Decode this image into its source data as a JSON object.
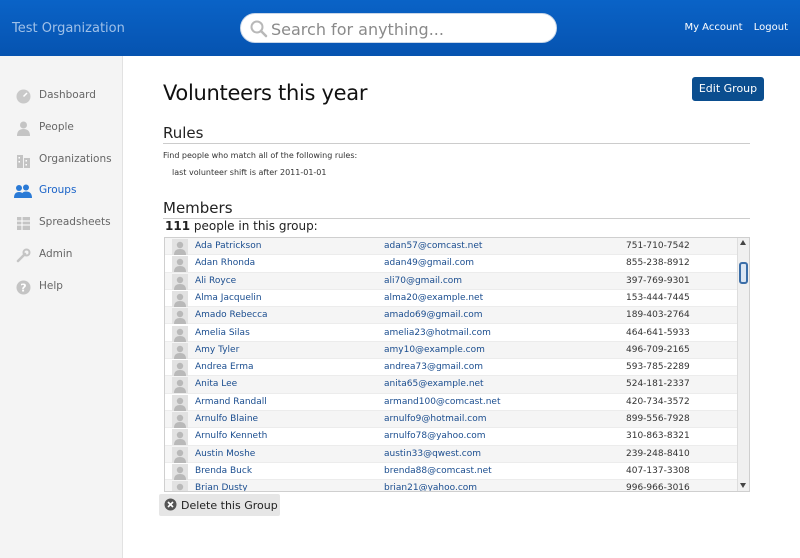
{
  "header": {
    "org_name": "Test Organization",
    "search_placeholder": "Search for anything...",
    "my_account": "My Account",
    "logout": "Logout"
  },
  "sidebar": {
    "items": [
      {
        "label": "Dashboard",
        "icon": "dashboard-icon"
      },
      {
        "label": "People",
        "icon": "person-icon"
      },
      {
        "label": "Organizations",
        "icon": "building-icon"
      },
      {
        "label": "Groups",
        "icon": "group-icon",
        "active": true
      },
      {
        "label": "Spreadsheets",
        "icon": "spreadsheet-icon"
      },
      {
        "label": "Admin",
        "icon": "wrench-icon"
      },
      {
        "label": "Help",
        "icon": "help-icon"
      }
    ]
  },
  "main": {
    "title": "Volunteers this year",
    "edit_button": "Edit Group",
    "rules_heading": "Rules",
    "rules_intro": "Find people who match  all of the following rules:",
    "rule_text": "last volunteer shift  is after  2011-01-01",
    "members_heading": "Members",
    "member_count": "111",
    "member_count_suffix": " people in this group:",
    "delete_button": "Delete this Group",
    "members": [
      {
        "name": "Ada Patrickson",
        "email": "adan57@comcast.net",
        "phone": "751-710-7542"
      },
      {
        "name": "Adan Rhonda",
        "email": "adan49@gmail.com",
        "phone": "855-238-8912"
      },
      {
        "name": "Ali Royce",
        "email": "ali70@gmail.com",
        "phone": "397-769-9301"
      },
      {
        "name": "Alma Jacquelin",
        "email": "alma20@example.net",
        "phone": "153-444-7445"
      },
      {
        "name": "Amado Rebecca",
        "email": "amado69@gmail.com",
        "phone": "189-403-2764"
      },
      {
        "name": "Amelia Silas",
        "email": "amelia23@hotmail.com",
        "phone": "464-641-5933"
      },
      {
        "name": "Amy Tyler",
        "email": "amy10@example.com",
        "phone": "496-709-2165"
      },
      {
        "name": "Andrea Erma",
        "email": "andrea73@gmail.com",
        "phone": "593-785-2289"
      },
      {
        "name": "Anita Lee",
        "email": "anita65@example.net",
        "phone": "524-181-2337"
      },
      {
        "name": "Armand Randall",
        "email": "armand100@comcast.net",
        "phone": "420-734-3572"
      },
      {
        "name": "Arnulfo Blaine",
        "email": "arnulfo9@hotmail.com",
        "phone": "899-556-7928"
      },
      {
        "name": "Arnulfo Kenneth",
        "email": "arnulfo78@yahoo.com",
        "phone": "310-863-8321"
      },
      {
        "name": "Austin Moshe",
        "email": "austin33@qwest.com",
        "phone": "239-248-8410"
      },
      {
        "name": "Brenda Buck",
        "email": "brenda88@comcast.net",
        "phone": "407-137-3308"
      },
      {
        "name": "Brian Dusty",
        "email": "brian21@yahoo.com",
        "phone": "996-966-3016"
      }
    ]
  },
  "colors": {
    "header_blue": "#0653b0",
    "link_blue": "#1a4d8f",
    "edit_button": "#0b4e8f"
  }
}
